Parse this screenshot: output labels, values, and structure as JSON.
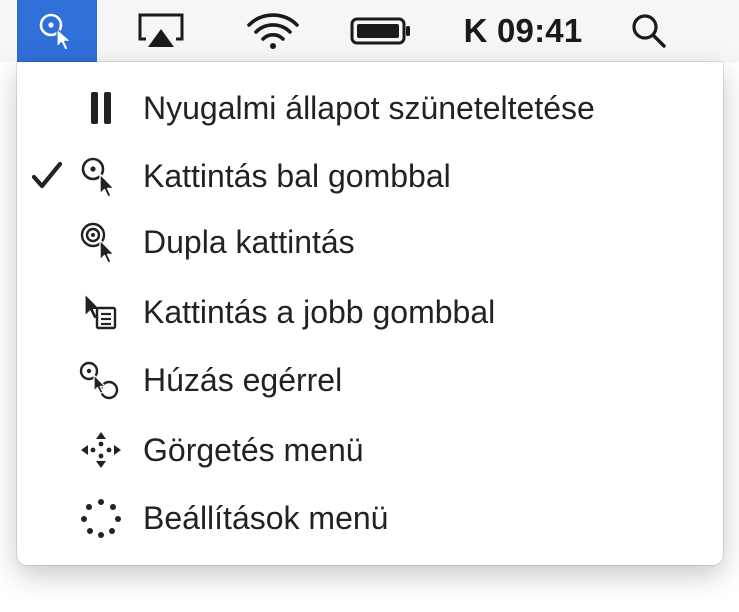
{
  "menubar": {
    "clock": "K 09:41",
    "icons": [
      "accessibility-pointer-icon",
      "airplay-icon",
      "wifi-icon",
      "battery-icon",
      "spotlight-search-icon"
    ],
    "active_color": "#2f6fd8"
  },
  "menu": {
    "items": [
      {
        "label": "Nyugalmi állapot szüneteltetése",
        "icon": "pause-icon",
        "checked": false
      },
      {
        "label": "Kattintás bal gombbal",
        "icon": "left-click-icon",
        "checked": true
      },
      {
        "label": "Dupla kattintás",
        "icon": "double-click-icon",
        "checked": false
      },
      {
        "label": "Kattintás a jobb gombbal",
        "icon": "right-click-icon",
        "checked": false
      },
      {
        "label": "Húzás egérrel",
        "icon": "drag-icon",
        "checked": false
      },
      {
        "label": "Görgetés menü",
        "icon": "scroll-menu-icon",
        "checked": false
      },
      {
        "label": "Beállítások menü",
        "icon": "settings-menu-icon",
        "checked": false
      }
    ]
  }
}
